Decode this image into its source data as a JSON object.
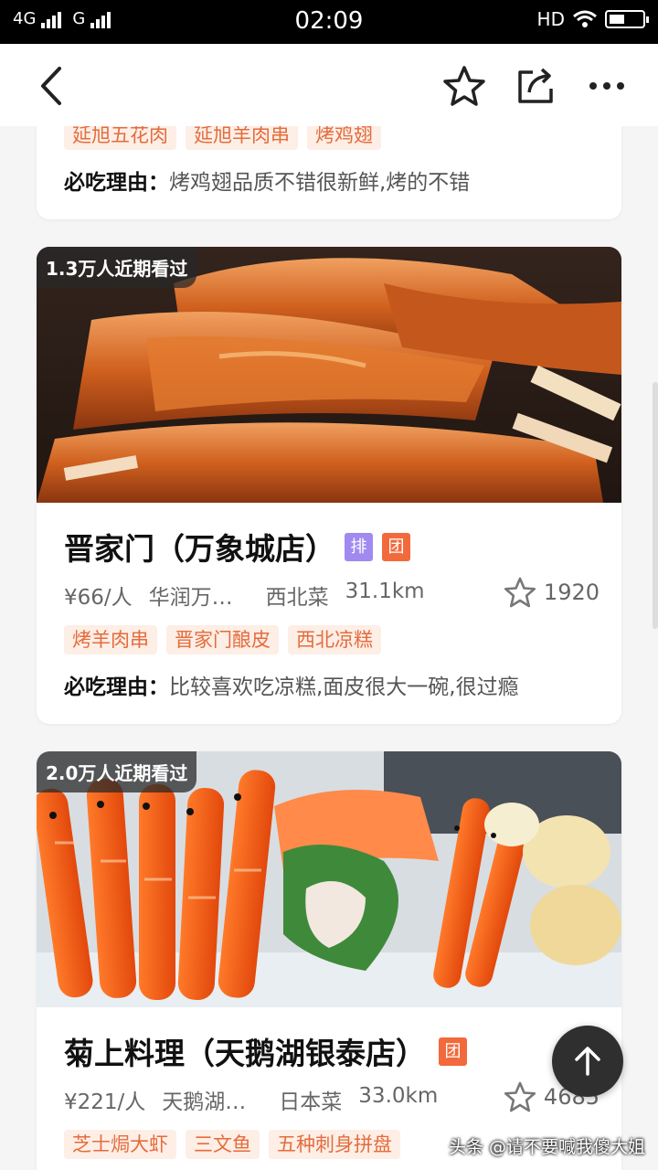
{
  "status_bar": {
    "net1": "4G",
    "net2": "G",
    "time": "02:09",
    "hd": "HD"
  },
  "nav": {
    "back_icon": "chevron-left-icon",
    "star_icon": "star-outline-icon",
    "share_icon": "share-icon",
    "more_icon": "more-dots-icon"
  },
  "cards": [
    {
      "tags": [
        "延旭五花肉",
        "延旭羊肉串",
        "烤鸡翅"
      ],
      "reason_label": "必吃理由：",
      "reason_text": "烤鸡翅品质不错很新鲜,烤的不错"
    },
    {
      "seen": "1.3万人近期看过",
      "name": "晋家门（万象城店）",
      "badges": [
        "排",
        "团"
      ],
      "price": "¥66/人",
      "area": "华润万…",
      "cuisine": "西北菜",
      "distance": "31.1km",
      "favorites": "1920",
      "tags": [
        "烤羊肉串",
        "晋家门酿皮",
        "西北凉糕"
      ],
      "reason_label": "必吃理由：",
      "reason_text": "比较喜欢吃凉糕,面皮很大一碗,很过瘾"
    },
    {
      "seen": "2.0万人近期看过",
      "name": "菊上料理（天鹅湖银泰店）",
      "badges": [
        "团"
      ],
      "price": "¥221/人",
      "area": "天鹅湖…",
      "cuisine": "日本菜",
      "distance": "33.0km",
      "favorites": "4685",
      "tags": [
        "芝士焗大虾",
        "三文鱼",
        "五种刺身拼盘"
      ]
    }
  ],
  "fab_icon": "arrow-up-icon",
  "watermark": "头条 @请不要喊我傻大姐"
}
